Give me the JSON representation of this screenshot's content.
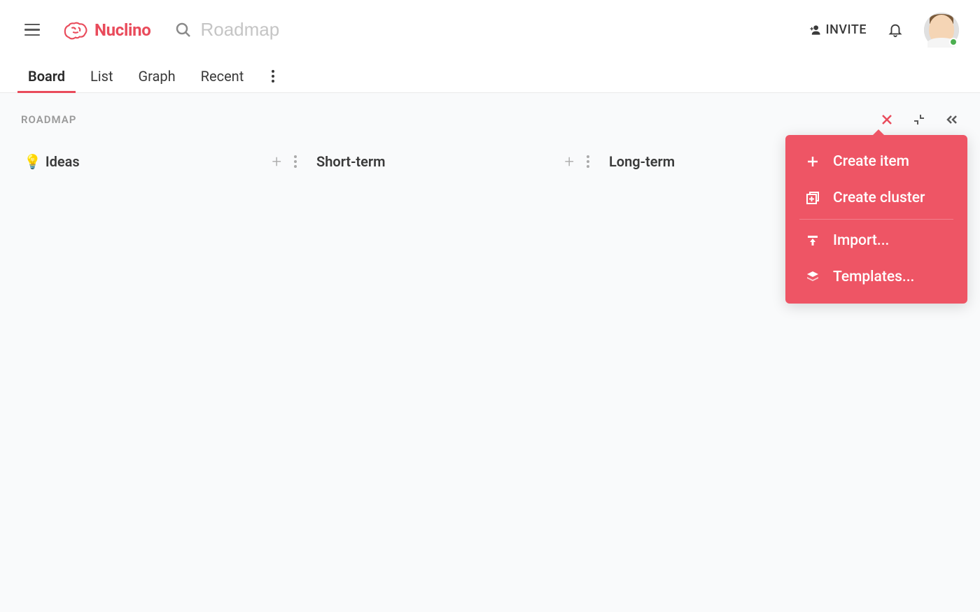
{
  "header": {
    "logo_text": "Nuclino",
    "search_placeholder": "Roadmap",
    "invite_label": "INVITE"
  },
  "tabs": [
    {
      "label": "Board",
      "active": true
    },
    {
      "label": "List",
      "active": false
    },
    {
      "label": "Graph",
      "active": false
    },
    {
      "label": "Recent",
      "active": false
    }
  ],
  "breadcrumb": "ROADMAP",
  "columns": [
    {
      "emoji": "💡",
      "title": "Ideas"
    },
    {
      "emoji": "",
      "title": "Short-term"
    },
    {
      "emoji": "",
      "title": "Long-term"
    }
  ],
  "dropdown": {
    "items": [
      {
        "icon": "plus",
        "label": "Create item"
      },
      {
        "icon": "cluster",
        "label": "Create cluster"
      },
      {
        "icon": "import",
        "label": "Import..."
      },
      {
        "icon": "templates",
        "label": "Templates..."
      }
    ]
  }
}
